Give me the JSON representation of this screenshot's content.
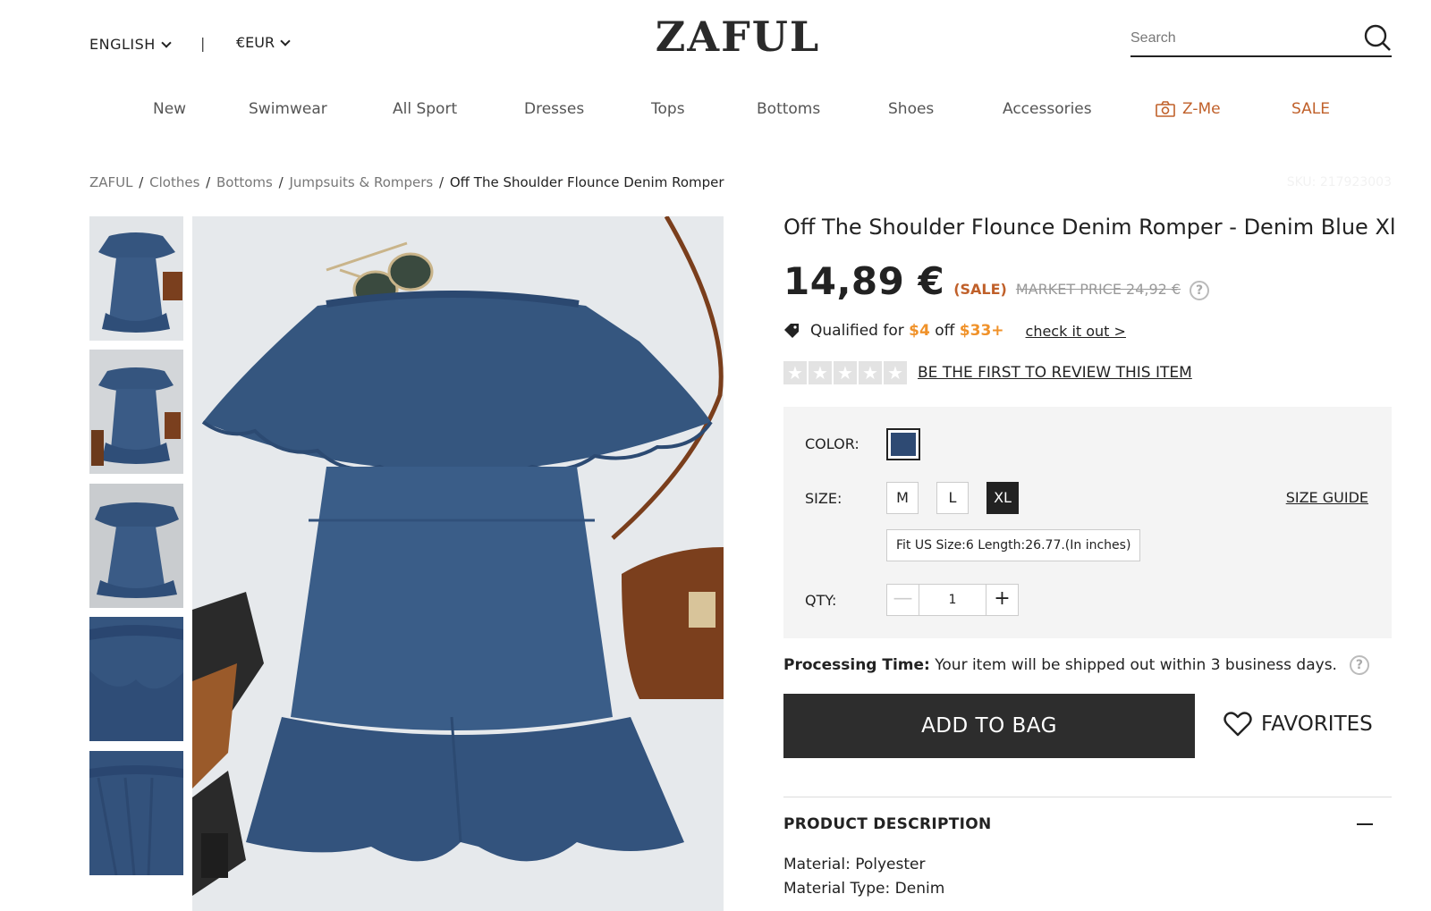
{
  "header": {
    "language": "ENGLISH",
    "separator": "|",
    "currency": "€EUR",
    "logo": "ZAFUL",
    "search_placeholder": "Search"
  },
  "nav": {
    "items": [
      "New",
      "Swimwear",
      "All Sport",
      "Dresses",
      "Tops",
      "Bottoms",
      "Shoes",
      "Accessories"
    ],
    "zme": "Z-Me",
    "sale": "SALE"
  },
  "breadcrumb": {
    "items": [
      "ZAFUL",
      "Clothes",
      "Bottoms",
      "Jumpsuits & Rompers"
    ],
    "current": "Off The Shoulder Flounce Denim Romper",
    "separator": "/"
  },
  "sku": "SKU: 217923003",
  "product": {
    "title": "Off The Shoulder Flounce Denim Romper - Denim Blue Xl",
    "price": "14,89 €",
    "sale_tag": "(SALE)",
    "market_price": "MARKET PRICE 24,92 €",
    "help_glyph": "?",
    "promo_prefix": "Qualified for",
    "promo_discount": "$4",
    "promo_mid": "off",
    "promo_threshold": "$33+",
    "promo_link": "check it out >",
    "rating_stars": 0,
    "review_link": "BE THE FIRST TO REVIEW THIS ITEM"
  },
  "options": {
    "color_label": "COLOR:",
    "color_swatch": "#2e4a73",
    "size_label": "SIZE:",
    "sizes": [
      "M",
      "L",
      "XL"
    ],
    "selected_size": "XL",
    "size_guide": "SIZE GUIDE",
    "fit_info": "Fit US Size:6   Length:26.77.(In inches)",
    "qty_label": "QTY:",
    "qty_value": "1",
    "qty_minus": "—",
    "qty_plus": "+"
  },
  "processing": {
    "label": "Processing Time:",
    "text": "Your item will be shipped out within 3 business days."
  },
  "actions": {
    "add_to_bag": "ADD TO BAG",
    "favorites": "FAVORITES"
  },
  "description": {
    "heading": "PRODUCT DESCRIPTION",
    "lines": [
      "Material: Polyester",
      "Material Type: Denim"
    ]
  },
  "colors": {
    "accent": "#c0602a",
    "promo_highlight": "#f0922a",
    "denim": "#2e4a73",
    "button_dark": "#2d2d2d"
  }
}
